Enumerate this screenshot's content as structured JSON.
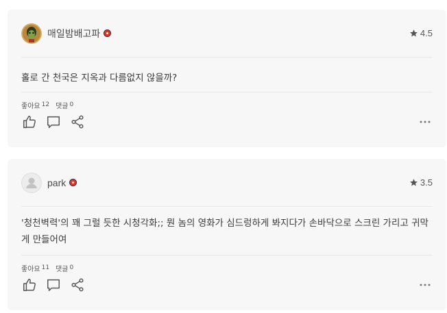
{
  "reviews": [
    {
      "username": "매일밤배고파",
      "rating": "4.5",
      "text": "홀로 간 천국은 지옥과 다름없지 않을까?",
      "likes_label": "좋아요",
      "likes_count": "12",
      "comments_label": "댓글",
      "comments_count": "0",
      "avatar": "cartoon-photo-avatar"
    },
    {
      "username": "park",
      "rating": "3.5",
      "text": "'청천벽력'의 꽤 그럴 듯한 시청각화;; 뭔 놈의 영화가 심드렁하게 봐지다가 손바닥으로 스크린 가리고 귀막게 만들어여",
      "likes_label": "좋아요",
      "likes_count": "11",
      "comments_label": "댓글",
      "comments_count": "0",
      "avatar": "default-user-avatar"
    }
  ],
  "colors": {
    "card_bg": "#f7f7f7",
    "badge": "#e0362d",
    "icon": "#555555"
  },
  "icons": [
    "star-icon",
    "thumbs-up-icon",
    "comment-icon",
    "share-icon",
    "more-icon"
  ]
}
